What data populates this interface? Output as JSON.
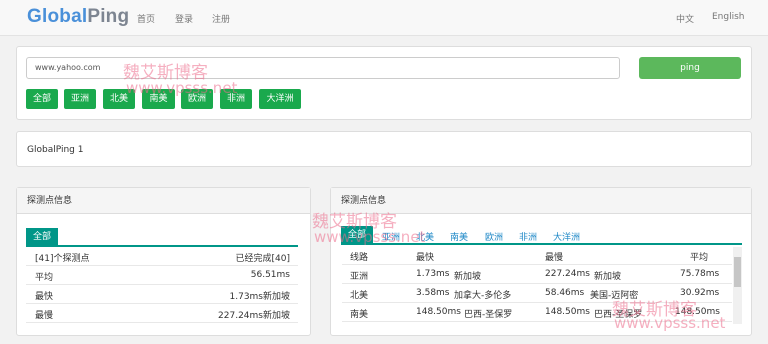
{
  "nav": {
    "logo_part1": "Global",
    "logo_part2": "Ping",
    "home": "首页",
    "login": "登录",
    "register": "注册",
    "lang_zh": "中文",
    "lang_en": "English"
  },
  "search": {
    "value": "www.yahoo.com",
    "button": "ping"
  },
  "regions": [
    "全部",
    "亚洲",
    "北美",
    "南美",
    "欧洲",
    "非洲",
    "大洋洲"
  ],
  "info": {
    "text": "GlobalPing 1"
  },
  "left_panel": {
    "title": "探测点信息",
    "tab": "全部",
    "rows": [
      {
        "label": "[41]个探测点",
        "value": "已经完成[40]"
      },
      {
        "label": "平均",
        "value": "56.51ms"
      },
      {
        "label": "最快",
        "value": "1.73ms新加坡"
      },
      {
        "label": "最慢",
        "value": "227.24ms新加坡"
      }
    ]
  },
  "right_panel": {
    "title": "探测点信息",
    "tabs": [
      "全部",
      "亚洲",
      "北美",
      "南美",
      "欧洲",
      "非洲",
      "大洋洲"
    ],
    "headers": [
      "线路",
      "最快",
      "最慢",
      "平均"
    ],
    "rows": [
      {
        "region": "亚洲",
        "fast_ms": "1.73ms",
        "fast_loc": "新加坡",
        "slow_ms": "227.24ms",
        "slow_loc": "新加坡",
        "avg": "75.78ms"
      },
      {
        "region": "北美",
        "fast_ms": "3.58ms",
        "fast_loc": "加拿大-多伦多",
        "slow_ms": "58.46ms",
        "slow_loc": "美国-迈阿密",
        "avg": "30.92ms"
      },
      {
        "region": "南美",
        "fast_ms": "148.50ms",
        "fast_loc": "巴西-圣保罗",
        "slow_ms": "148.50ms",
        "slow_loc": "巴西-圣保罗",
        "avg": "148.50ms"
      }
    ]
  },
  "watermarks": {
    "cn": "魏艾斯博客",
    "url": "www.vpsss.net"
  },
  "colors": {
    "logo_blue": "#4a90d9",
    "ping_green": "#5cb85c",
    "region_green": "#1aa94d",
    "tab_teal": "#009688",
    "tab_link_blue": "#1e88c7"
  }
}
